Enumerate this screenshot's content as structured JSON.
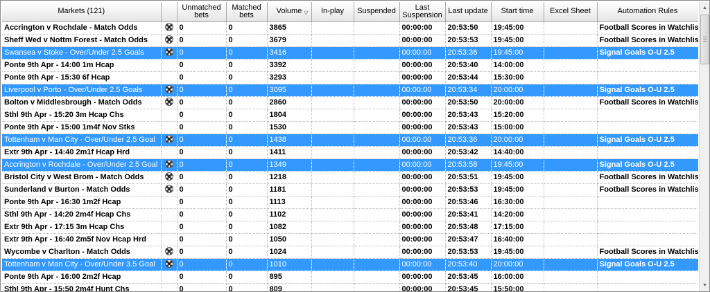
{
  "columns": {
    "markets": "Markets (121)",
    "unmatched": "Unmatched bets",
    "matched": "Matched bets",
    "volume": "Volume",
    "inplay": "In-play",
    "suspended": "Suspended",
    "last_suspension": "Last Suspension",
    "last_update": "Last update",
    "start_time": "Start time",
    "excel_sheet": "Excel Sheet",
    "automation_rules": "Automation Rules"
  },
  "icons": {
    "sort_indicator": "sort-descending-icon",
    "soccer": "soccer-ball-icon"
  },
  "colors": {
    "selection": "#3399ff",
    "header": "#f0f0f0"
  },
  "rows": [
    {
      "market": "Accrington v Rochdale - Match Odds",
      "ball": true,
      "unmatched": "0",
      "matched": "0",
      "volume": "3865",
      "inplay": "",
      "suspended": "",
      "last_suspension": "00:00:00",
      "last_update": "20:53:50",
      "start_time": "19:45:00",
      "excel": "",
      "rule": "Football Scores in Watchlist",
      "selected": false
    },
    {
      "market": "Sheff Wed v Nottm Forest - Match Odds",
      "ball": true,
      "unmatched": "0",
      "matched": "0",
      "volume": "3679",
      "inplay": "",
      "suspended": "",
      "last_suspension": "00:00:00",
      "last_update": "20:53:53",
      "start_time": "19:45:00",
      "excel": "",
      "rule": "Football Scores in Watchlist",
      "selected": false
    },
    {
      "market": "Swansea v Stoke - Over/Under 2.5 Goals",
      "ball": true,
      "unmatched": "0",
      "matched": "0",
      "volume": "3416",
      "inplay": "",
      "suspended": "",
      "last_suspension": "00:00:00",
      "last_update": "20:53:36",
      "start_time": "19:45:00",
      "excel": "",
      "rule": "Signal Goals O-U 2.5",
      "selected": true
    },
    {
      "market": "Ponte 9th Apr - 14:00 1m Hcap",
      "ball": false,
      "unmatched": "0",
      "matched": "0",
      "volume": "3392",
      "inplay": "",
      "suspended": "",
      "last_suspension": "00:00:00",
      "last_update": "20:53:40",
      "start_time": "14:00:00",
      "excel": "",
      "rule": "",
      "selected": false
    },
    {
      "market": "Ponte 9th Apr - 15:30 6f Hcap",
      "ball": false,
      "unmatched": "0",
      "matched": "0",
      "volume": "3293",
      "inplay": "",
      "suspended": "",
      "last_suspension": "00:00:00",
      "last_update": "20:53:44",
      "start_time": "15:30:00",
      "excel": "",
      "rule": "",
      "selected": false
    },
    {
      "market": "Liverpool v Porto - Over/Under 2.5 Goals",
      "ball": true,
      "unmatched": "0",
      "matched": "0",
      "volume": "3095",
      "inplay": "",
      "suspended": "",
      "last_suspension": "00:00:00",
      "last_update": "20:53:34",
      "start_time": "20:00:00",
      "excel": "",
      "rule": "Signal Goals O-U 2.5",
      "selected": true
    },
    {
      "market": "Bolton v Middlesbrough - Match Odds",
      "ball": true,
      "unmatched": "0",
      "matched": "0",
      "volume": "2860",
      "inplay": "",
      "suspended": "",
      "last_suspension": "00:00:00",
      "last_update": "20:53:50",
      "start_time": "20:00:00",
      "excel": "",
      "rule": "Football Scores in Watchlist",
      "selected": false
    },
    {
      "market": "Sthl 9th Apr - 15:20 3m Hcap Chs",
      "ball": false,
      "unmatched": "0",
      "matched": "0",
      "volume": "1804",
      "inplay": "",
      "suspended": "",
      "last_suspension": "00:00:00",
      "last_update": "20:53:43",
      "start_time": "15:20:00",
      "excel": "",
      "rule": "",
      "selected": false
    },
    {
      "market": "Ponte 9th Apr - 15:00 1m4f Nov Stks",
      "ball": false,
      "unmatched": "0",
      "matched": "0",
      "volume": "1530",
      "inplay": "",
      "suspended": "",
      "last_suspension": "00:00:00",
      "last_update": "20:53:43",
      "start_time": "15:00:00",
      "excel": "",
      "rule": "",
      "selected": false
    },
    {
      "market": "Tottenham v Man City - Over/Under 2.5 Goal",
      "ball": true,
      "unmatched": "0",
      "matched": "0",
      "volume": "1438",
      "inplay": "",
      "suspended": "",
      "last_suspension": "00:00:00",
      "last_update": "20:53:36",
      "start_time": "20:00:00",
      "excel": "",
      "rule": "Signal Goals O-U 2.5",
      "selected": true
    },
    {
      "market": "Extr 9th Apr - 14:40 2m1f Hcap Hrd",
      "ball": false,
      "unmatched": "0",
      "matched": "0",
      "volume": "1411",
      "inplay": "",
      "suspended": "",
      "last_suspension": "00:00:00",
      "last_update": "20:53:42",
      "start_time": "14:40:00",
      "excel": "",
      "rule": "",
      "selected": false
    },
    {
      "market": "Accrington v Rochdale - Over/Under 2.5 Goal",
      "ball": true,
      "unmatched": "0",
      "matched": "0",
      "volume": "1349",
      "inplay": "",
      "suspended": "",
      "last_suspension": "00:00:00",
      "last_update": "20:53:58",
      "start_time": "19:45:00",
      "excel": "",
      "rule": "Signal Goals O-U 2.5",
      "selected": true
    },
    {
      "market": "Bristol City v West Brom - Match Odds",
      "ball": true,
      "unmatched": "0",
      "matched": "0",
      "volume": "1218",
      "inplay": "",
      "suspended": "",
      "last_suspension": "00:00:00",
      "last_update": "20:53:51",
      "start_time": "19:45:00",
      "excel": "",
      "rule": "Football Scores in Watchlist",
      "selected": false
    },
    {
      "market": "Sunderland v Burton - Match Odds",
      "ball": true,
      "unmatched": "0",
      "matched": "0",
      "volume": "1181",
      "inplay": "",
      "suspended": "",
      "last_suspension": "00:00:00",
      "last_update": "20:53:53",
      "start_time": "19:45:00",
      "excel": "",
      "rule": "Football Scores in Watchlist",
      "selected": false
    },
    {
      "market": "Ponte 9th Apr - 16:30 1m2f Hcap",
      "ball": false,
      "unmatched": "0",
      "matched": "0",
      "volume": "1113",
      "inplay": "",
      "suspended": "",
      "last_suspension": "00:00:00",
      "last_update": "20:53:46",
      "start_time": "16:30:00",
      "excel": "",
      "rule": "",
      "selected": false
    },
    {
      "market": "Sthl 9th Apr - 14:20 2m4f Hcap Chs",
      "ball": false,
      "unmatched": "0",
      "matched": "0",
      "volume": "1102",
      "inplay": "",
      "suspended": "",
      "last_suspension": "00:00:00",
      "last_update": "20:53:41",
      "start_time": "14:20:00",
      "excel": "",
      "rule": "",
      "selected": false
    },
    {
      "market": "Extr 9th Apr - 17:15 3m Hcap Chs",
      "ball": false,
      "unmatched": "0",
      "matched": "0",
      "volume": "1082",
      "inplay": "",
      "suspended": "",
      "last_suspension": "00:00:00",
      "last_update": "20:53:48",
      "start_time": "17:15:00",
      "excel": "",
      "rule": "",
      "selected": false
    },
    {
      "market": "Extr 9th Apr - 16:40 2m5f Nov Hcap Hrd",
      "ball": false,
      "unmatched": "0",
      "matched": "0",
      "volume": "1050",
      "inplay": "",
      "suspended": "",
      "last_suspension": "00:00:00",
      "last_update": "20:53:47",
      "start_time": "16:40:00",
      "excel": "",
      "rule": "",
      "selected": false
    },
    {
      "market": "Wycombe v Charlton - Match Odds",
      "ball": true,
      "unmatched": "0",
      "matched": "0",
      "volume": "1024",
      "inplay": "",
      "suspended": "",
      "last_suspension": "00:00:00",
      "last_update": "20:53:53",
      "start_time": "19:45:00",
      "excel": "",
      "rule": "Football Scores in Watchlist",
      "selected": false
    },
    {
      "market": "Tottenham v Man City - Over/Under 3.5 Goal",
      "ball": true,
      "unmatched": "0",
      "matched": "0",
      "volume": "1010",
      "inplay": "",
      "suspended": "",
      "last_suspension": "00:00:00",
      "last_update": "20:53:40",
      "start_time": "20:00:00",
      "excel": "",
      "rule": "Signal Goals O-U 2.5",
      "selected": true
    },
    {
      "market": "Ponte 9th Apr - 16:00 2m2f Hcap",
      "ball": false,
      "unmatched": "0",
      "matched": "0",
      "volume": "895",
      "inplay": "",
      "suspended": "",
      "last_suspension": "00:00:00",
      "last_update": "20:53:45",
      "start_time": "16:00:00",
      "excel": "",
      "rule": "",
      "selected": false
    },
    {
      "market": "Sthl 9th Apr - 15:50 2m4f Hunt Chs",
      "ball": false,
      "unmatched": "0",
      "matched": "0",
      "volume": "809",
      "inplay": "",
      "suspended": "",
      "last_suspension": "00:00:00",
      "last_update": "20:53:45",
      "start_time": "15:50:00",
      "excel": "",
      "rule": "",
      "selected": false
    }
  ]
}
